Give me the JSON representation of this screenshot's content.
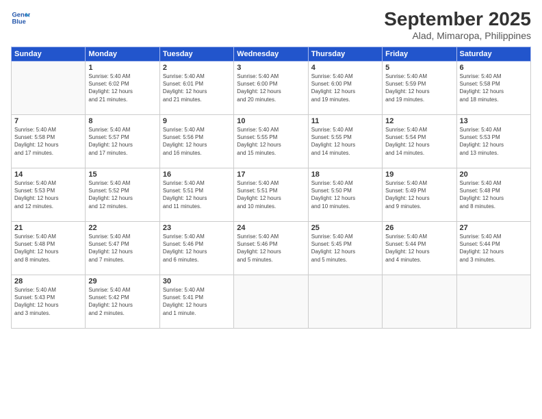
{
  "header": {
    "logo_line1": "General",
    "logo_line2": "Blue",
    "month": "September 2025",
    "location": "Alad, Mimaropa, Philippines"
  },
  "weekdays": [
    "Sunday",
    "Monday",
    "Tuesday",
    "Wednesday",
    "Thursday",
    "Friday",
    "Saturday"
  ],
  "weeks": [
    [
      {
        "day": "",
        "info": ""
      },
      {
        "day": "1",
        "info": "Sunrise: 5:40 AM\nSunset: 6:02 PM\nDaylight: 12 hours\nand 21 minutes."
      },
      {
        "day": "2",
        "info": "Sunrise: 5:40 AM\nSunset: 6:01 PM\nDaylight: 12 hours\nand 21 minutes."
      },
      {
        "day": "3",
        "info": "Sunrise: 5:40 AM\nSunset: 6:00 PM\nDaylight: 12 hours\nand 20 minutes."
      },
      {
        "day": "4",
        "info": "Sunrise: 5:40 AM\nSunset: 6:00 PM\nDaylight: 12 hours\nand 19 minutes."
      },
      {
        "day": "5",
        "info": "Sunrise: 5:40 AM\nSunset: 5:59 PM\nDaylight: 12 hours\nand 19 minutes."
      },
      {
        "day": "6",
        "info": "Sunrise: 5:40 AM\nSunset: 5:58 PM\nDaylight: 12 hours\nand 18 minutes."
      }
    ],
    [
      {
        "day": "7",
        "info": "Sunrise: 5:40 AM\nSunset: 5:58 PM\nDaylight: 12 hours\nand 17 minutes."
      },
      {
        "day": "8",
        "info": "Sunrise: 5:40 AM\nSunset: 5:57 PM\nDaylight: 12 hours\nand 17 minutes."
      },
      {
        "day": "9",
        "info": "Sunrise: 5:40 AM\nSunset: 5:56 PM\nDaylight: 12 hours\nand 16 minutes."
      },
      {
        "day": "10",
        "info": "Sunrise: 5:40 AM\nSunset: 5:55 PM\nDaylight: 12 hours\nand 15 minutes."
      },
      {
        "day": "11",
        "info": "Sunrise: 5:40 AM\nSunset: 5:55 PM\nDaylight: 12 hours\nand 14 minutes."
      },
      {
        "day": "12",
        "info": "Sunrise: 5:40 AM\nSunset: 5:54 PM\nDaylight: 12 hours\nand 14 minutes."
      },
      {
        "day": "13",
        "info": "Sunrise: 5:40 AM\nSunset: 5:53 PM\nDaylight: 12 hours\nand 13 minutes."
      }
    ],
    [
      {
        "day": "14",
        "info": "Sunrise: 5:40 AM\nSunset: 5:53 PM\nDaylight: 12 hours\nand 12 minutes."
      },
      {
        "day": "15",
        "info": "Sunrise: 5:40 AM\nSunset: 5:52 PM\nDaylight: 12 hours\nand 12 minutes."
      },
      {
        "day": "16",
        "info": "Sunrise: 5:40 AM\nSunset: 5:51 PM\nDaylight: 12 hours\nand 11 minutes."
      },
      {
        "day": "17",
        "info": "Sunrise: 5:40 AM\nSunset: 5:51 PM\nDaylight: 12 hours\nand 10 minutes."
      },
      {
        "day": "18",
        "info": "Sunrise: 5:40 AM\nSunset: 5:50 PM\nDaylight: 12 hours\nand 10 minutes."
      },
      {
        "day": "19",
        "info": "Sunrise: 5:40 AM\nSunset: 5:49 PM\nDaylight: 12 hours\nand 9 minutes."
      },
      {
        "day": "20",
        "info": "Sunrise: 5:40 AM\nSunset: 5:48 PM\nDaylight: 12 hours\nand 8 minutes."
      }
    ],
    [
      {
        "day": "21",
        "info": "Sunrise: 5:40 AM\nSunset: 5:48 PM\nDaylight: 12 hours\nand 8 minutes."
      },
      {
        "day": "22",
        "info": "Sunrise: 5:40 AM\nSunset: 5:47 PM\nDaylight: 12 hours\nand 7 minutes."
      },
      {
        "day": "23",
        "info": "Sunrise: 5:40 AM\nSunset: 5:46 PM\nDaylight: 12 hours\nand 6 minutes."
      },
      {
        "day": "24",
        "info": "Sunrise: 5:40 AM\nSunset: 5:46 PM\nDaylight: 12 hours\nand 5 minutes."
      },
      {
        "day": "25",
        "info": "Sunrise: 5:40 AM\nSunset: 5:45 PM\nDaylight: 12 hours\nand 5 minutes."
      },
      {
        "day": "26",
        "info": "Sunrise: 5:40 AM\nSunset: 5:44 PM\nDaylight: 12 hours\nand 4 minutes."
      },
      {
        "day": "27",
        "info": "Sunrise: 5:40 AM\nSunset: 5:44 PM\nDaylight: 12 hours\nand 3 minutes."
      }
    ],
    [
      {
        "day": "28",
        "info": "Sunrise: 5:40 AM\nSunset: 5:43 PM\nDaylight: 12 hours\nand 3 minutes."
      },
      {
        "day": "29",
        "info": "Sunrise: 5:40 AM\nSunset: 5:42 PM\nDaylight: 12 hours\nand 2 minutes."
      },
      {
        "day": "30",
        "info": "Sunrise: 5:40 AM\nSunset: 5:41 PM\nDaylight: 12 hours\nand 1 minute."
      },
      {
        "day": "",
        "info": ""
      },
      {
        "day": "",
        "info": ""
      },
      {
        "day": "",
        "info": ""
      },
      {
        "day": "",
        "info": ""
      }
    ]
  ]
}
